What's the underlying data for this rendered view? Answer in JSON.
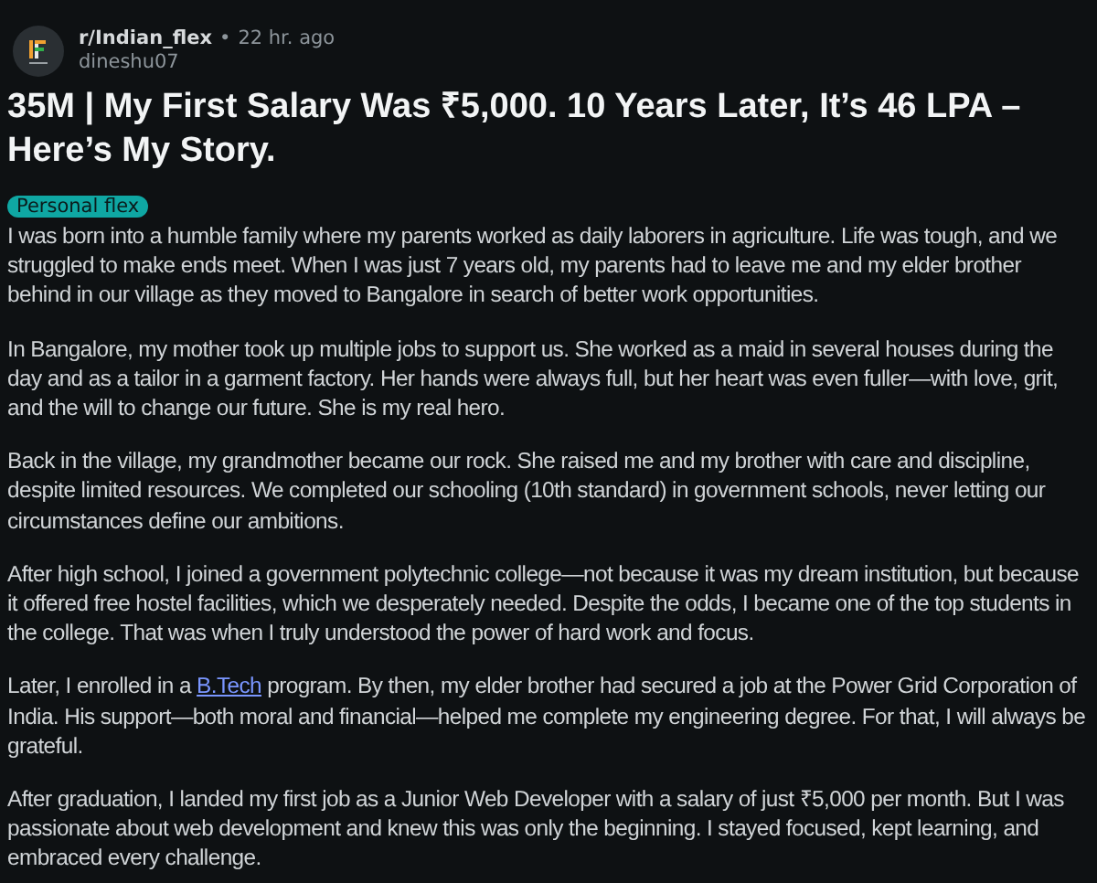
{
  "post": {
    "subreddit": "r/Indian_flex",
    "separator": "•",
    "time": "22 hr. ago",
    "author": "dineshu07",
    "title": "35M | My First Salary Was ₹5,000. 10 Years Later, It’s 46 LPA – Here’s My Story.",
    "flair": "Personal flex",
    "paragraphs": [
      [
        {
          "kind": "text",
          "text": "I was born into a humble family where my parents worked as daily laborers in agriculture. Life was tough, and we struggled to make ends meet. When I was just 7 years old, my parents had to leave me and my elder brother behind in our village as they moved to Bangalore in search of better work opportunities."
        }
      ],
      [
        {
          "kind": "text",
          "text": "In Bangalore, my mother took up multiple jobs to support us. She worked as a maid in several houses during the day and as a tailor in a garment factory. Her hands were always full, but her heart was even fuller—with love, grit, and the will to change our future. She is my real hero."
        }
      ],
      [
        {
          "kind": "text",
          "text": "Back in the village, my grandmother became our rock. She raised me and my brother with care and discipline, despite limited resources. We completed our schooling (10th standard) in government schools, never letting our circumstances define our ambitions."
        }
      ],
      [
        {
          "kind": "text",
          "text": "After high school, I joined a government polytechnic college—not because it was my dream institution, but because it offered free hostel facilities, which we desperately needed. Despite the odds, I became one of the top students in the college. That was when I truly understood the power of hard work and focus."
        }
      ],
      [
        {
          "kind": "text",
          "text": "Later, I enrolled in a "
        },
        {
          "kind": "link",
          "text": "B.Tech"
        },
        {
          "kind": "text",
          "text": " program. By then, my elder brother had secured a job at the Power Grid Corporation of India. His support—both moral and financial—helped me complete my engineering degree. For that, I will always be grateful."
        }
      ],
      [
        {
          "kind": "text",
          "text": "After graduation, I landed my first job as a Junior Web Developer with a salary of just ₹5,000 per month. But I was passionate about web development and knew this was only the beginning. I stayed focused, kept learning, and embraced every challenge."
        }
      ]
    ]
  }
}
